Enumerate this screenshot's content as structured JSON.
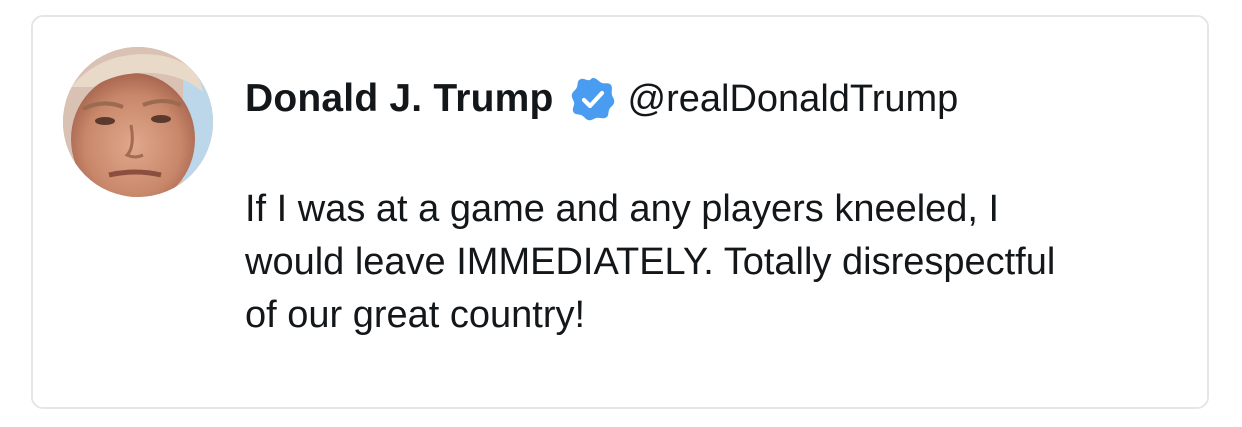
{
  "tweet": {
    "author": {
      "display_name": "Donald J. Trump",
      "handle": "@realDonaldTrump",
      "verified": true,
      "verified_icon": "verified-badge-icon",
      "verified_color": "#4a9cf0"
    },
    "text_lines": [
      "If I was at a game and any players kneeled, I",
      "would leave IMMEDIATELY. Totally disrespectful",
      "of our great country!"
    ]
  },
  "colors": {
    "text": "#14171a",
    "border": "#e6e6e6",
    "background": "#ffffff"
  }
}
